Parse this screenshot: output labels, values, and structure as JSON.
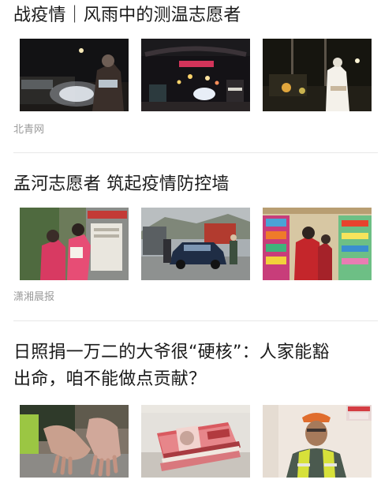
{
  "feed": {
    "items": [
      {
        "title": "战疫情｜风雨中的测温志愿者",
        "source": "北青网",
        "thumbnails": [
          {
            "name": "night-checkpoint-car-photo"
          },
          {
            "name": "night-road-lights-photo"
          },
          {
            "name": "night-volunteer-standing-photo"
          }
        ]
      },
      {
        "title": "孟河志愿者 筑起疫情防控墙",
        "source": "潇湘晨报",
        "thumbnails": [
          {
            "name": "volunteers-notice-board-photo"
          },
          {
            "name": "roadside-car-checkpoint-photo"
          },
          {
            "name": "shop-shelves-volunteer-photo"
          }
        ]
      },
      {
        "title_line1": "日照捐一万二的大爷很“硬核”：人家能豁",
        "title_line2": "出命，咱不能做点贡献？",
        "thumbnails": [
          {
            "name": "worn-hands-photo"
          },
          {
            "name": "cash-banknotes-photo"
          },
          {
            "name": "elderly-man-vest-photo"
          }
        ]
      }
    ]
  }
}
